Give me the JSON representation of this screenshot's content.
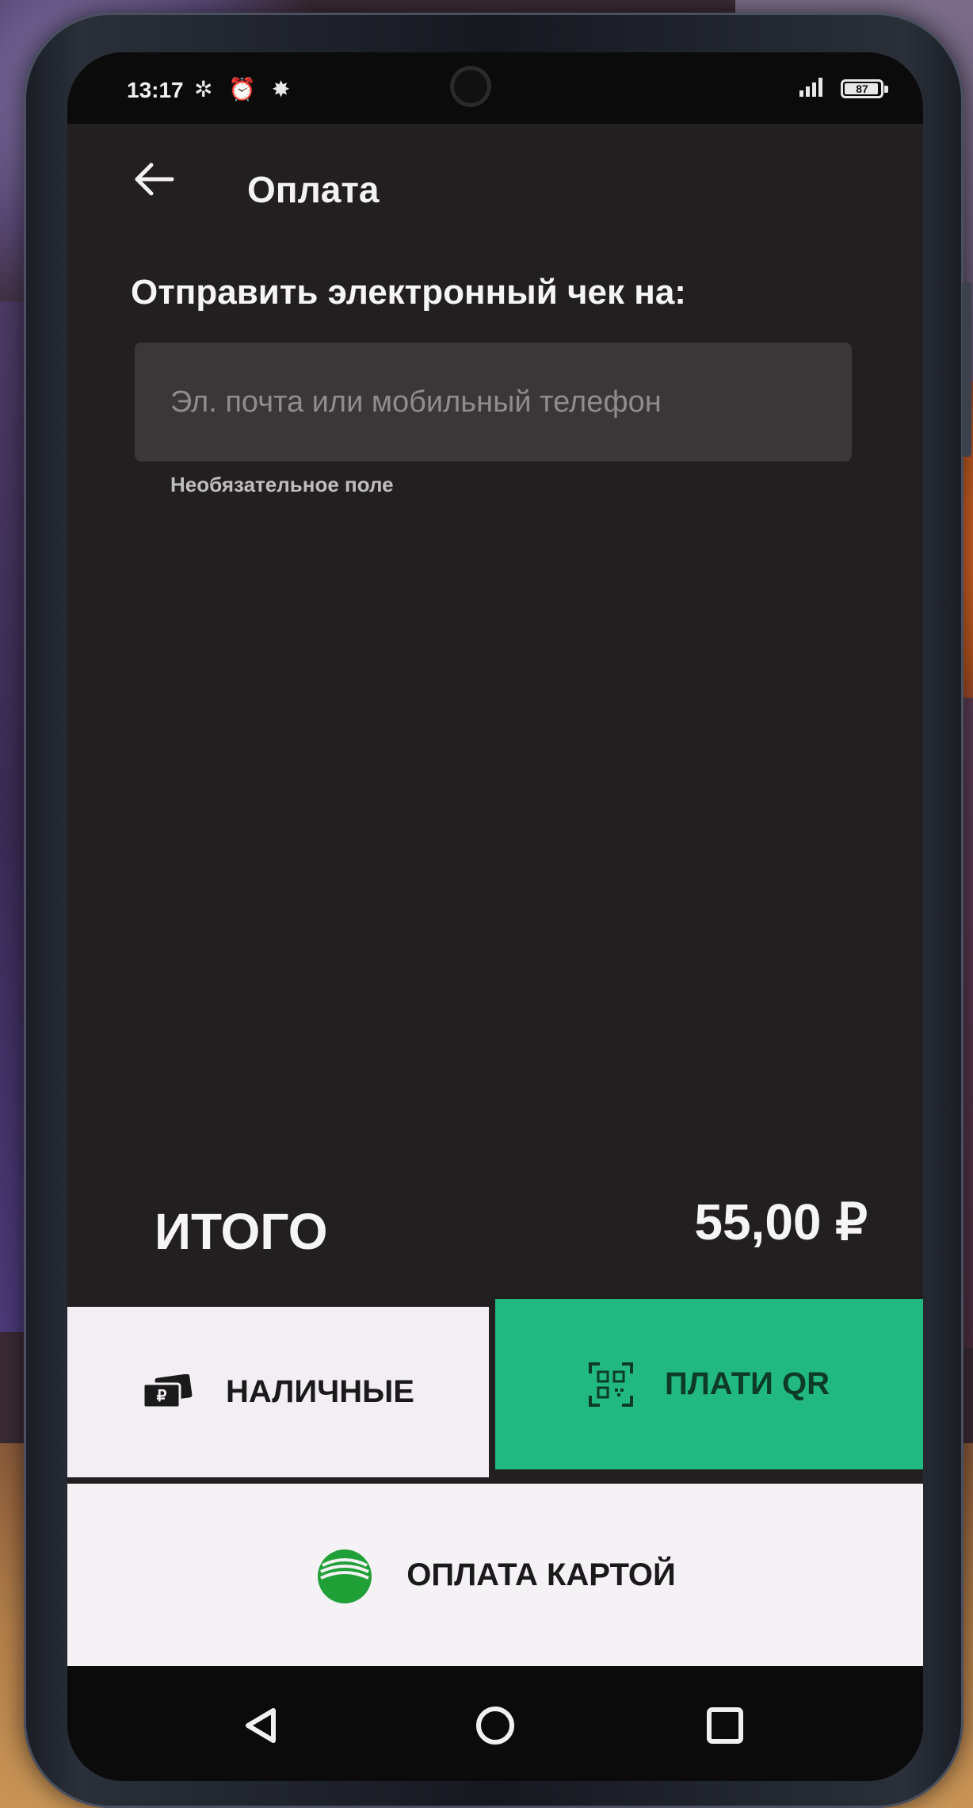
{
  "status_bar": {
    "time": "13:17",
    "icons": [
      "notification-icon",
      "alarm-icon",
      "bug-icon"
    ],
    "battery": "87"
  },
  "header": {
    "title": "Оплата"
  },
  "receipt": {
    "label": "Отправить электронный чек на:",
    "placeholder": "Эл. почта или мобильный телефон",
    "hint": "Необязательное поле"
  },
  "total": {
    "label": "ИТОГО",
    "value": "55,00 ₽"
  },
  "payment": {
    "cash_label": "НАЛИЧНЫЕ",
    "qr_label": "ПЛАТИ QR",
    "card_label": "ОПЛАТА КАРТОЙ"
  },
  "colors": {
    "screen_bg": "#221f20",
    "qr_button": "#21b981",
    "light_button": "#f2eef4",
    "sber_green": "#21a038"
  }
}
